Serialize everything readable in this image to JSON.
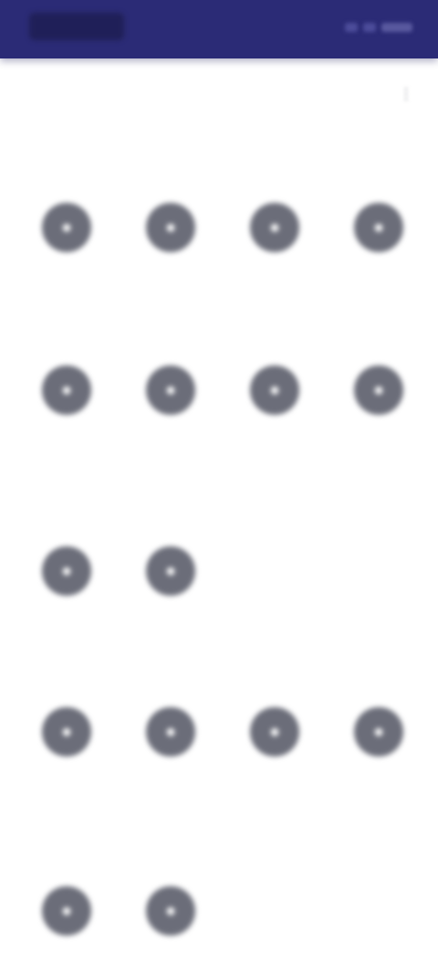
{
  "status_bar": {
    "time": "",
    "indicators": [
      "",
      "",
      ""
    ]
  },
  "header": {
    "title": "",
    "action_icon": "more-icon"
  },
  "colors": {
    "top_bar": "#2b2b76",
    "icon_fill": "#6b6d79",
    "background": "#ffffff"
  },
  "sections": [
    {
      "title": "",
      "items": [
        {
          "icon": "app-icon",
          "label": ""
        },
        {
          "icon": "app-icon",
          "label": ""
        },
        {
          "icon": "app-icon",
          "label": ""
        },
        {
          "icon": "app-icon",
          "label": ""
        }
      ]
    },
    {
      "title": "",
      "items": [
        {
          "icon": "app-icon",
          "label": ""
        },
        {
          "icon": "app-icon",
          "label": ""
        },
        {
          "icon": "app-icon",
          "label": ""
        },
        {
          "icon": "app-icon",
          "label": ""
        }
      ]
    },
    {
      "title": "",
      "items": [
        {
          "icon": "app-icon",
          "label": ""
        },
        {
          "icon": "app-icon",
          "label": ""
        }
      ]
    },
    {
      "title": "",
      "items": [
        {
          "icon": "app-icon",
          "label": ""
        },
        {
          "icon": "app-icon",
          "label": ""
        },
        {
          "icon": "app-icon",
          "label": ""
        },
        {
          "icon": "app-icon",
          "label": ""
        }
      ]
    },
    {
      "title": "",
      "items": [
        {
          "icon": "app-icon",
          "label": ""
        },
        {
          "icon": "app-icon",
          "label": ""
        }
      ]
    }
  ]
}
